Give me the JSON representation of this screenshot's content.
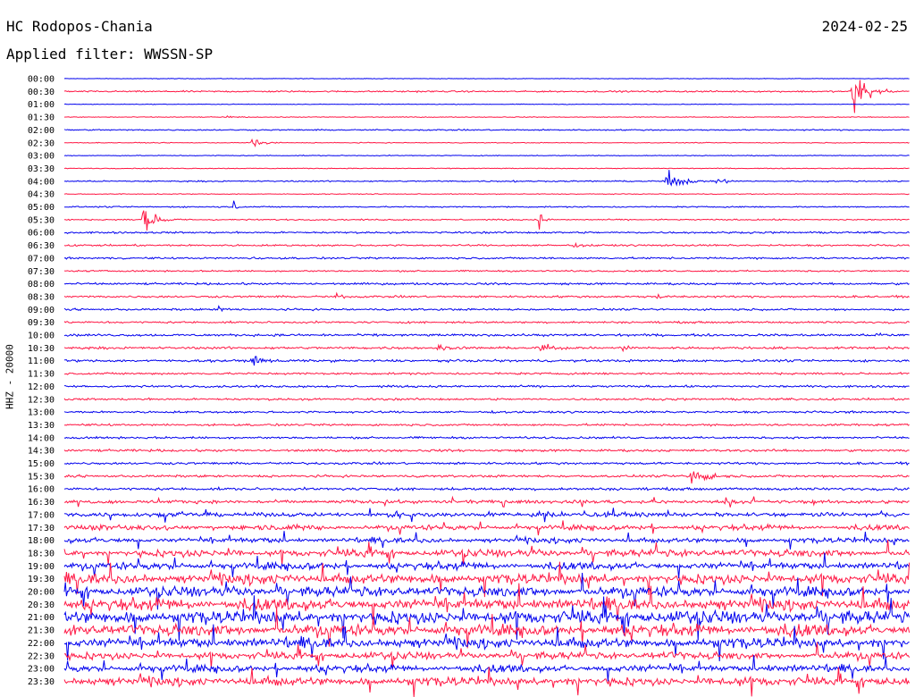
{
  "header": {
    "station": "HC Rodopos-Chania",
    "date": "2024-02-25",
    "filter": "Applied filter: WWSSN-SP"
  },
  "colors": {
    "blue": "#0000ee",
    "red": "#ff1744",
    "background": "#ffffff"
  },
  "chart_data": {
    "type": "line",
    "title": "HC Rodopos-Chania",
    "subtitle": "Applied filter: WWSSN-SP",
    "ylabel": "HHZ - 20000",
    "xlabel": "",
    "x_axis": "time within each 30-minute trace",
    "trace_colors_alternate": [
      "#0000ee",
      "#ff1744"
    ],
    "traces": [
      {
        "label": "00:00",
        "color": "blue",
        "amplitude": 0.4
      },
      {
        "label": "00:30",
        "color": "red",
        "amplitude": 1.2
      },
      {
        "label": "01:00",
        "color": "blue",
        "amplitude": 0.5
      },
      {
        "label": "01:30",
        "color": "red",
        "amplitude": 0.6
      },
      {
        "label": "02:00",
        "color": "blue",
        "amplitude": 1.0
      },
      {
        "label": "02:30",
        "color": "red",
        "amplitude": 0.6
      },
      {
        "label": "03:00",
        "color": "blue",
        "amplitude": 0.6
      },
      {
        "label": "03:30",
        "color": "red",
        "amplitude": 0.6
      },
      {
        "label": "04:00",
        "color": "blue",
        "amplitude": 1.0
      },
      {
        "label": "04:30",
        "color": "red",
        "amplitude": 0.6
      },
      {
        "label": "05:00",
        "color": "blue",
        "amplitude": 1.0
      },
      {
        "label": "05:30",
        "color": "red",
        "amplitude": 1.0
      },
      {
        "label": "06:00",
        "color": "blue",
        "amplitude": 1.4
      },
      {
        "label": "06:30",
        "color": "red",
        "amplitude": 1.4
      },
      {
        "label": "07:00",
        "color": "blue",
        "amplitude": 1.4
      },
      {
        "label": "07:30",
        "color": "red",
        "amplitude": 1.2
      },
      {
        "label": "08:00",
        "color": "blue",
        "amplitude": 1.6
      },
      {
        "label": "08:30",
        "color": "red",
        "amplitude": 1.6
      },
      {
        "label": "09:00",
        "color": "blue",
        "amplitude": 1.5
      },
      {
        "label": "09:30",
        "color": "red",
        "amplitude": 1.5
      },
      {
        "label": "10:00",
        "color": "blue",
        "amplitude": 1.8
      },
      {
        "label": "10:30",
        "color": "red",
        "amplitude": 1.8
      },
      {
        "label": "11:00",
        "color": "blue",
        "amplitude": 1.8
      },
      {
        "label": "11:30",
        "color": "red",
        "amplitude": 1.6
      },
      {
        "label": "12:00",
        "color": "blue",
        "amplitude": 1.6
      },
      {
        "label": "12:30",
        "color": "red",
        "amplitude": 1.6
      },
      {
        "label": "13:00",
        "color": "blue",
        "amplitude": 1.6
      },
      {
        "label": "13:30",
        "color": "red",
        "amplitude": 1.6
      },
      {
        "label": "14:00",
        "color": "blue",
        "amplitude": 1.6
      },
      {
        "label": "14:30",
        "color": "red",
        "amplitude": 1.8
      },
      {
        "label": "15:00",
        "color": "blue",
        "amplitude": 1.8
      },
      {
        "label": "15:30",
        "color": "red",
        "amplitude": 1.8
      },
      {
        "label": "16:00",
        "color": "blue",
        "amplitude": 2.0
      },
      {
        "label": "16:30",
        "color": "red",
        "amplitude": 2.5
      },
      {
        "label": "17:00",
        "color": "blue",
        "amplitude": 3.0
      },
      {
        "label": "17:30",
        "color": "red",
        "amplitude": 3.5
      },
      {
        "label": "18:00",
        "color": "blue",
        "amplitude": 3.5
      },
      {
        "label": "18:30",
        "color": "red",
        "amplitude": 5.0
      },
      {
        "label": "19:00",
        "color": "blue",
        "amplitude": 5.0
      },
      {
        "label": "19:30",
        "color": "red",
        "amplitude": 7.0
      },
      {
        "label": "20:00",
        "color": "blue",
        "amplitude": 7.0
      },
      {
        "label": "20:30",
        "color": "red",
        "amplitude": 8.0
      },
      {
        "label": "21:00",
        "color": "blue",
        "amplitude": 9.0
      },
      {
        "label": "21:30",
        "color": "red",
        "amplitude": 8.0
      },
      {
        "label": "22:00",
        "color": "blue",
        "amplitude": 7.0
      },
      {
        "label": "22:30",
        "color": "red",
        "amplitude": 5.0
      },
      {
        "label": "23:00",
        "color": "blue",
        "amplitude": 5.0
      },
      {
        "label": "23:30",
        "color": "red",
        "amplitude": 6.0
      }
    ],
    "events": [
      {
        "trace": "00:30",
        "pos": 0.93,
        "amp": 30,
        "dur": 0.06,
        "note": "large earthquake"
      },
      {
        "trace": "01:30",
        "pos": 0.19,
        "amp": 3,
        "dur": 0.02
      },
      {
        "trace": "02:30",
        "pos": 0.22,
        "amp": 6,
        "dur": 0.05
      },
      {
        "trace": "04:00",
        "pos": 0.53,
        "amp": 3,
        "dur": 0.02
      },
      {
        "trace": "04:00",
        "pos": 0.71,
        "amp": 14,
        "dur": 0.06
      },
      {
        "trace": "04:00",
        "pos": 0.77,
        "amp": 6,
        "dur": 0.04
      },
      {
        "trace": "05:00",
        "pos": 0.2,
        "amp": 14,
        "dur": 0.01
      },
      {
        "trace": "05:30",
        "pos": 0.09,
        "amp": 16,
        "dur": 0.06
      },
      {
        "trace": "05:30",
        "pos": 0.56,
        "amp": 12,
        "dur": 0.02
      },
      {
        "trace": "06:30",
        "pos": 0.6,
        "amp": 4,
        "dur": 0.03
      },
      {
        "trace": "07:00",
        "pos": 0.22,
        "amp": 4,
        "dur": 0.02
      },
      {
        "trace": "08:30",
        "pos": 0.32,
        "amp": 4,
        "dur": 0.03
      },
      {
        "trace": "08:30",
        "pos": 0.7,
        "amp": 4,
        "dur": 0.03
      },
      {
        "trace": "09:00",
        "pos": 0.18,
        "amp": 7,
        "dur": 0.03
      },
      {
        "trace": "10:00",
        "pos": 0.96,
        "amp": 6,
        "dur": 0.03
      },
      {
        "trace": "10:30",
        "pos": 0.44,
        "amp": 6,
        "dur": 0.04
      },
      {
        "trace": "10:30",
        "pos": 0.56,
        "amp": 7,
        "dur": 0.06
      },
      {
        "trace": "10:30",
        "pos": 0.66,
        "amp": 6,
        "dur": 0.04
      },
      {
        "trace": "11:00",
        "pos": 0.22,
        "amp": 6,
        "dur": 0.06
      },
      {
        "trace": "15:30",
        "pos": 0.74,
        "amp": 22,
        "dur": 0.05
      },
      {
        "trace": "17:00",
        "pos": 0.38,
        "amp": 9,
        "dur": 0.05
      },
      {
        "trace": "17:00",
        "pos": 0.55,
        "amp": 6,
        "dur": 0.08
      }
    ]
  }
}
